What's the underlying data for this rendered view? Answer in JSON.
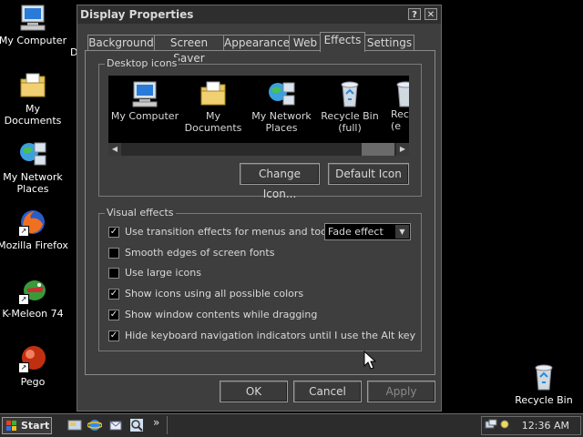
{
  "desktop": {
    "icons": [
      {
        "label": "My Computer",
        "icon": "my-computer-icon"
      },
      {
        "label": "My Documents",
        "icon": "my-documents-icon"
      },
      {
        "label": "My Network Places",
        "icon": "network-places-icon"
      },
      {
        "label": "Mozilla Firefox",
        "icon": "firefox-icon"
      },
      {
        "label": "K-Meleon 74",
        "icon": "kmeleon-icon"
      },
      {
        "label": "Pego",
        "icon": "pego-icon"
      },
      {
        "label": "Recycle Bin",
        "icon": "recycle-bin-icon"
      }
    ],
    "partial_letter": "D"
  },
  "dialog": {
    "title": "Display Properties",
    "help_glyph": "?",
    "close_glyph": "✕",
    "tabs": [
      {
        "label": "Background"
      },
      {
        "label": "Screen Saver"
      },
      {
        "label": "Appearance"
      },
      {
        "label": "Web"
      },
      {
        "label": "Effects",
        "active": true
      },
      {
        "label": "Settings"
      }
    ],
    "desktop_icons": {
      "group_label": "Desktop icons",
      "items": [
        {
          "line1": "My Computer",
          "line2": ""
        },
        {
          "line1": "My Documents",
          "line2": ""
        },
        {
          "line1": "My Network",
          "line2": "Places"
        },
        {
          "line1": "Recycle Bin",
          "line2": "(full)"
        },
        {
          "line1": "Recy",
          "line2": "(e"
        }
      ],
      "change_icon_label": "Change Icon...",
      "default_icon_label": "Default Icon"
    },
    "visual_effects": {
      "group_label": "Visual effects",
      "options": [
        {
          "label": "Use transition effects for menus and tooltips",
          "checked": true
        },
        {
          "label": "Smooth edges of screen fonts",
          "checked": false
        },
        {
          "label": "Use large icons",
          "checked": false
        },
        {
          "label": "Show icons using all possible colors",
          "checked": true
        },
        {
          "label": "Show window contents while dragging",
          "checked": true
        },
        {
          "label": "Hide keyboard navigation indicators until I use the Alt key",
          "checked": true
        }
      ],
      "transition_select_value": "Fade effect"
    },
    "buttons": {
      "ok": "OK",
      "cancel": "Cancel",
      "apply": "Apply"
    }
  },
  "taskbar": {
    "start_label": "Start",
    "more_glyph": "»",
    "clock": "12:36 AM"
  },
  "glyphs": {
    "check": "✓",
    "arrow_left": "◀",
    "arrow_right": "▶",
    "arrow_down": "▼"
  }
}
